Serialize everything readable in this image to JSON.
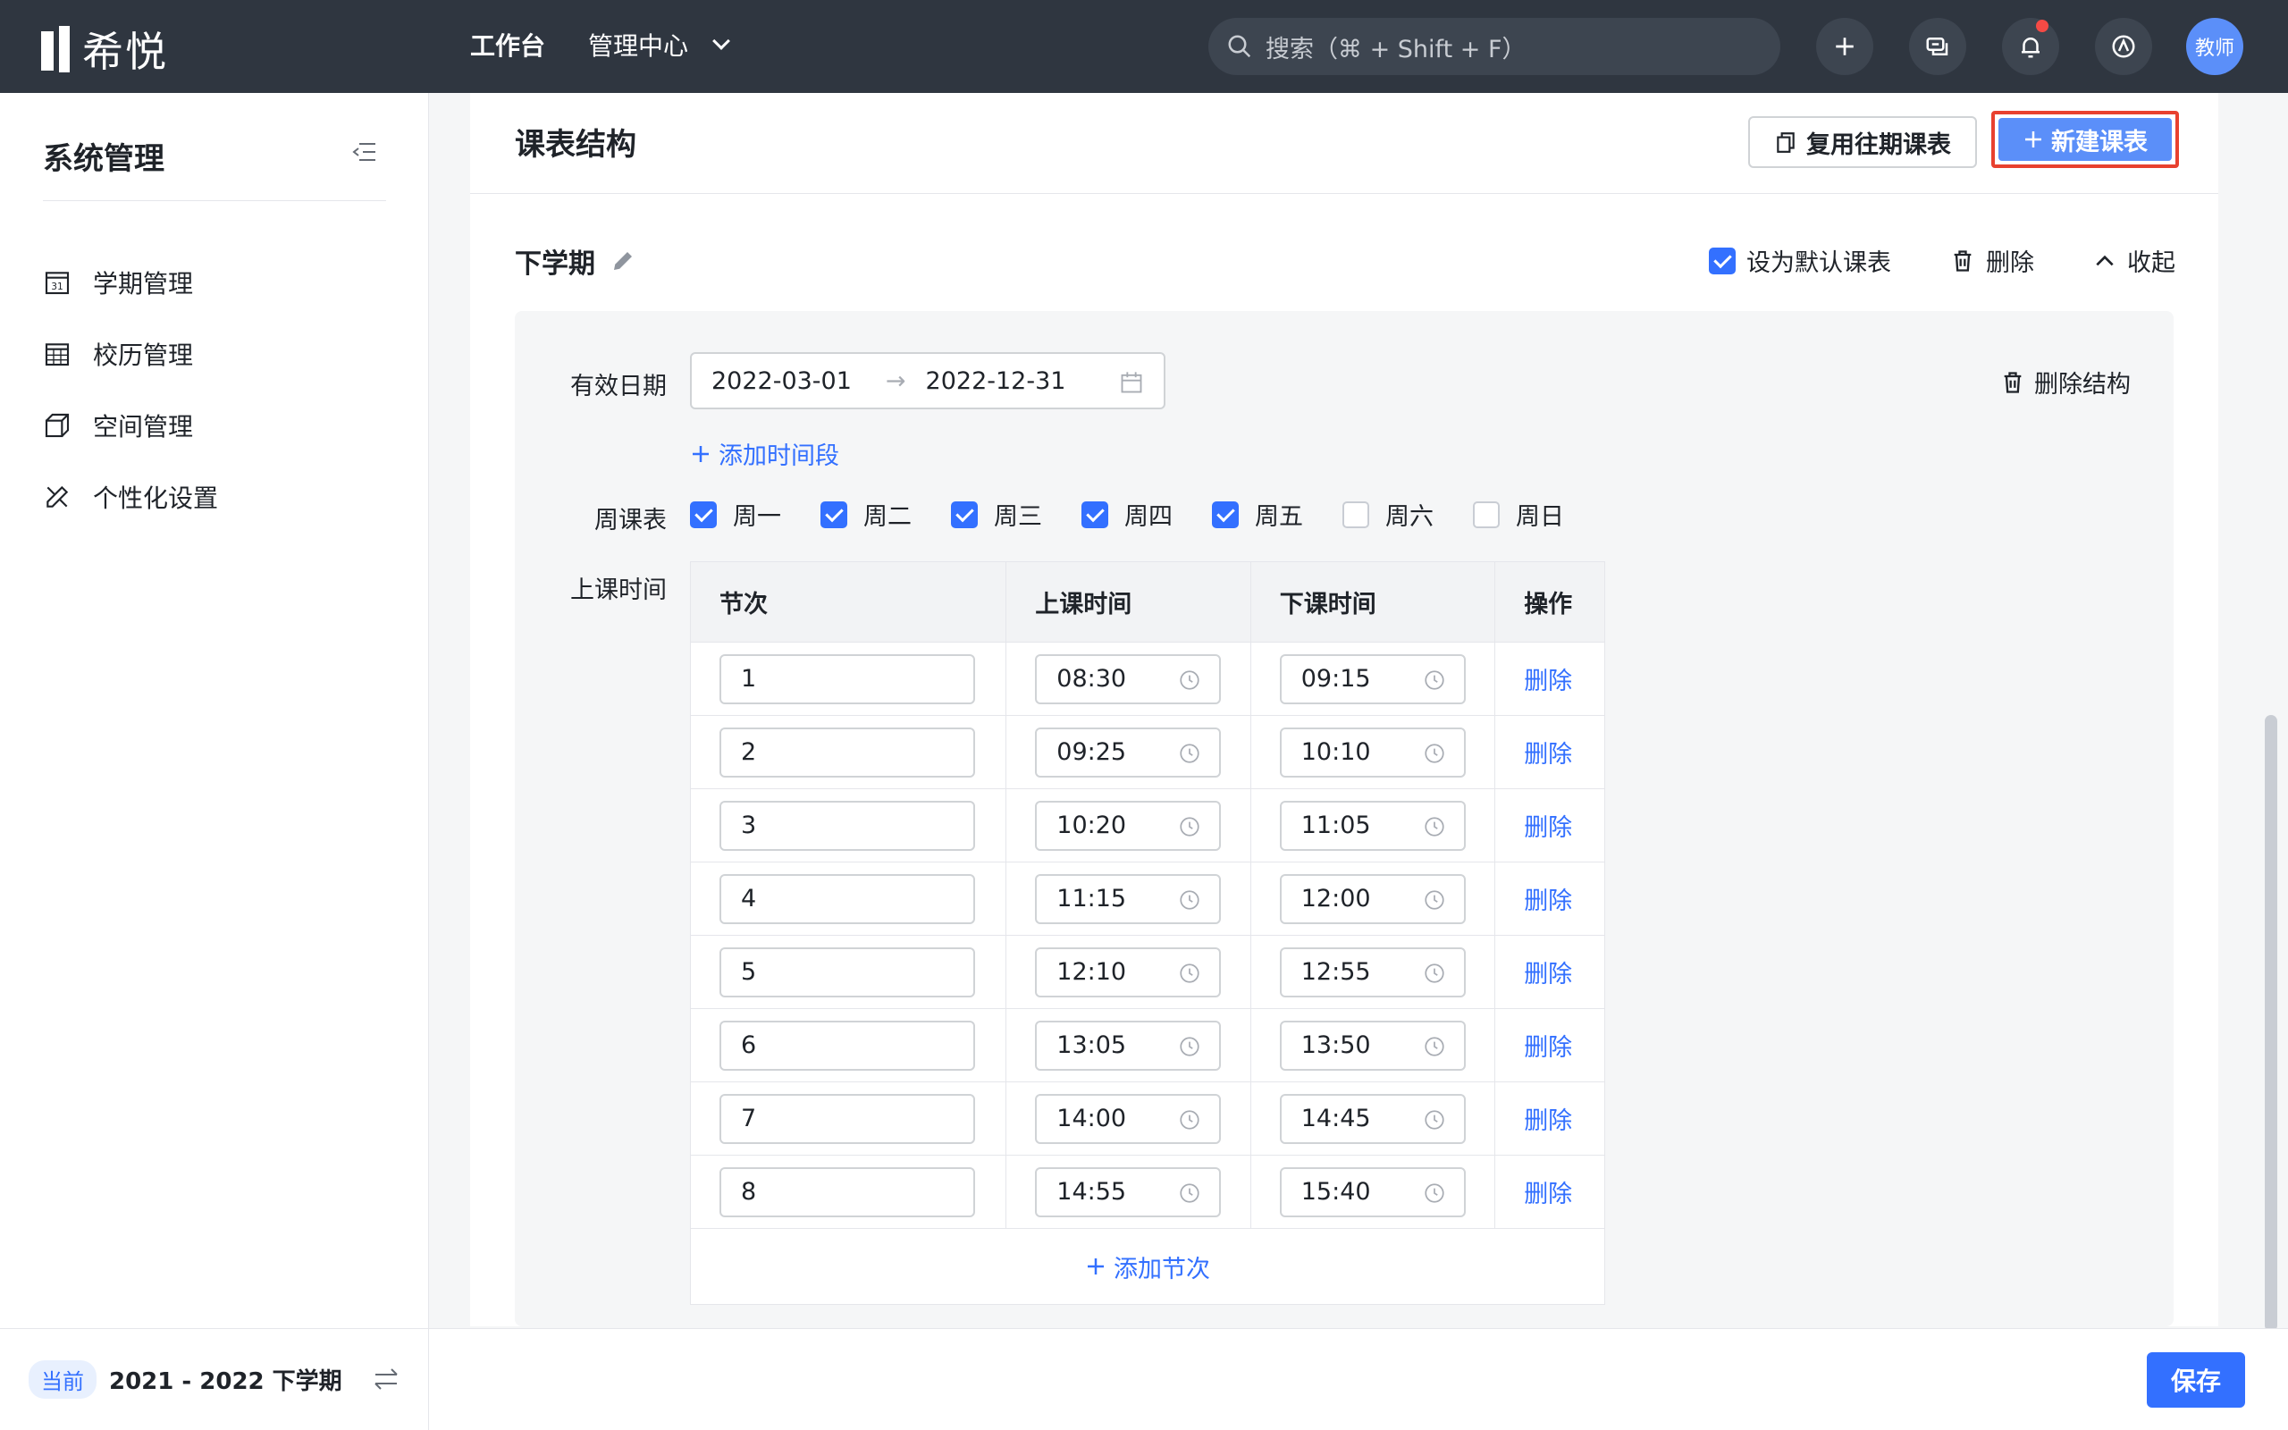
{
  "app": {
    "logo_text": "希悦"
  },
  "nav": {
    "workbench": "工作台",
    "admin_center": "管理中心"
  },
  "search": {
    "placeholder": "搜索（⌘ + Shift + F）"
  },
  "user": {
    "avatar_label": "教师"
  },
  "sidebar": {
    "title": "系统管理",
    "items": [
      {
        "label": "学期管理",
        "icon": "calendar-31-icon"
      },
      {
        "label": "校历管理",
        "icon": "calendar-grid-icon"
      },
      {
        "label": "空间管理",
        "icon": "cube-icon"
      },
      {
        "label": "个性化设置",
        "icon": "pencil-ruler-icon"
      }
    ],
    "footer": {
      "tag": "当前",
      "term": "2021 - 2022 下学期"
    }
  },
  "main": {
    "title": "课表结构",
    "reuse_button": "复用往期课表",
    "new_button": "新建课表",
    "section": {
      "name": "下学期",
      "default_label": "设为默认课表",
      "default_checked": true,
      "delete_label": "删除",
      "collapse_label": "收起"
    },
    "effective_date": {
      "label": "有效日期",
      "start": "2022-03-01",
      "end": "2022-12-31",
      "add_period": "添加时间段",
      "delete_structure": "删除结构"
    },
    "weekly": {
      "label": "周课表",
      "days": [
        {
          "label": "周一",
          "checked": true
        },
        {
          "label": "周二",
          "checked": true
        },
        {
          "label": "周三",
          "checked": true
        },
        {
          "label": "周四",
          "checked": true
        },
        {
          "label": "周五",
          "checked": true
        },
        {
          "label": "周六",
          "checked": false
        },
        {
          "label": "周日",
          "checked": false
        }
      ]
    },
    "class_time": {
      "label": "上课时间",
      "headers": [
        "节次",
        "上课时间",
        "下课时间",
        "操作"
      ],
      "rows": [
        {
          "no": "1",
          "start": "08:30",
          "end": "09:15",
          "action": "删除"
        },
        {
          "no": "2",
          "start": "09:25",
          "end": "10:10",
          "action": "删除"
        },
        {
          "no": "3",
          "start": "10:20",
          "end": "11:05",
          "action": "删除"
        },
        {
          "no": "4",
          "start": "11:15",
          "end": "12:00",
          "action": "删除"
        },
        {
          "no": "5",
          "start": "12:10",
          "end": "12:55",
          "action": "删除"
        },
        {
          "no": "6",
          "start": "13:05",
          "end": "13:50",
          "action": "删除"
        },
        {
          "no": "7",
          "start": "14:00",
          "end": "14:45",
          "action": "删除"
        },
        {
          "no": "8",
          "start": "14:55",
          "end": "15:40",
          "action": "删除"
        }
      ],
      "add_row": "添加节次"
    }
  },
  "footer": {
    "save": "保存"
  },
  "colors": {
    "primary": "#3370ff",
    "new_button": "#5b8ff9",
    "highlight_border": "#e8412f",
    "topbar": "#2f3640"
  }
}
